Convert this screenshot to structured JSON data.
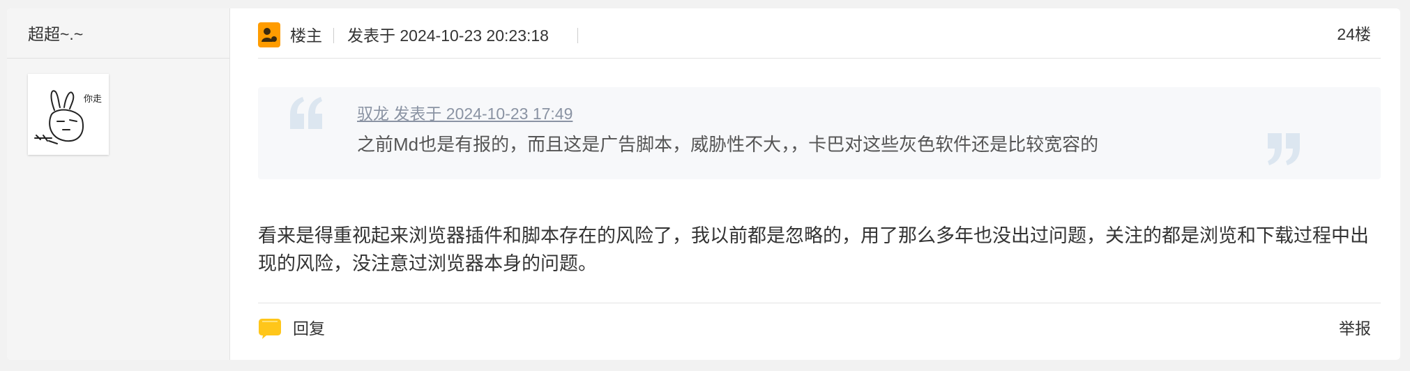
{
  "author": {
    "name": "超超~.~",
    "avatar_icon": "doodle-rabbit-avatar",
    "avatar_caption": "你走"
  },
  "header": {
    "owner_label": "楼主",
    "owner_icon": "user-badge-icon",
    "post_time": "发表于 2024-10-23 20:23:18",
    "floor": "24楼"
  },
  "quote": {
    "source": "驭龙 发表于 2024-10-23 17:49",
    "text": "之前Md也是有报的，而且这是广告脚本，威胁性不大，，卡巴对这些灰色软件还是比较宽容的"
  },
  "body": {
    "text": "看来是得重视起来浏览器插件和脚本存在的风险了，我以前都是忽略的，用了那么多年也没出过问题，关注的都是浏览和下载过程中出现的风险，没注意过浏览器本身的问题。"
  },
  "footer": {
    "reply_label": "回复",
    "reply_icon": "speech-bubble-icon",
    "report_label": "举报"
  },
  "colors": {
    "accent": "#ff9c00",
    "quote_bg": "#f7f8fa",
    "quote_mark": "#dce6f0",
    "link_gray": "#8a93a3"
  }
}
